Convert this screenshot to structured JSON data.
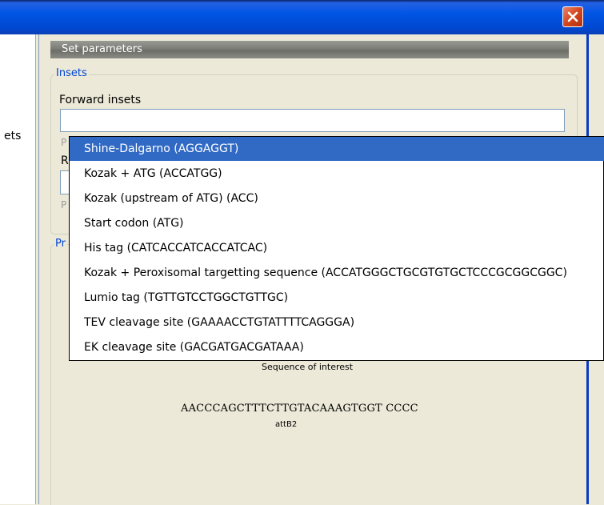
{
  "window": {
    "close_icon": "close-icon"
  },
  "left_pane": {
    "label": "ets"
  },
  "panel": {
    "header": "Set parameters",
    "insets_group": {
      "label": "Insets",
      "forward_label": "Forward insets",
      "forward_value": "",
      "hint_letter_1": "P",
      "reverse_letter": "R",
      "hint_letter_2": "P"
    },
    "second_group": {
      "label": "Pr"
    },
    "diagram": {
      "sequence_label": "Sequence of interest",
      "sequence": "AACCCAGCTTTCTTGTACAAAGTGGT CCCC",
      "att_label": "attB2"
    }
  },
  "dropdown": {
    "selected_index": 0,
    "selected_color": "#316ac5",
    "items": [
      "Shine-Dalgarno (AGGAGGT)",
      "Kozak + ATG (ACCATGG)",
      "Kozak (upstream of ATG) (ACC)",
      "Start codon (ATG)",
      "His tag (CATCACCATCACCATCAC)",
      "Kozak + Peroxisomal targetting sequence (ACCATGGGCTGCGTGTGCTCCCGCGGCGGC)",
      "Lumio tag (TGTTGTCCTGGCTGTTGC)",
      "TEV cleavage site (GAAAACCTGTATTTTCAGGGA)",
      "EK cleavage site (GACGATGACGATAAA)"
    ]
  }
}
